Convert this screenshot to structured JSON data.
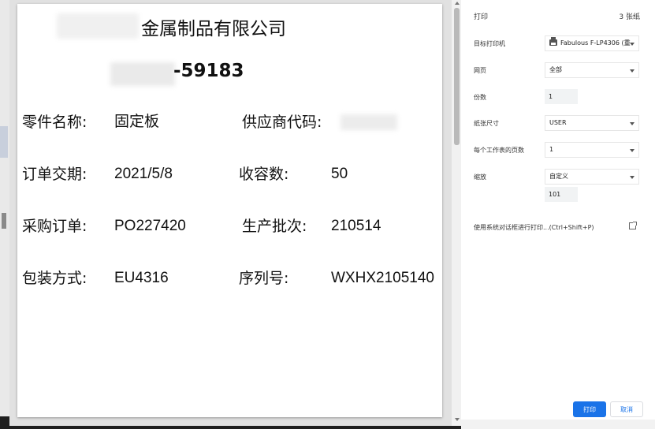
{
  "document": {
    "company_suffix": "金属制品有限公司",
    "code_suffix": "-59183",
    "fields": [
      {
        "label": "零件名称:",
        "value": "固定板"
      },
      {
        "label": "供应商代码:",
        "value": ""
      },
      {
        "label": "订单交期:",
        "value": "2021/5/8"
      },
      {
        "label": "收容数:",
        "value": "50"
      },
      {
        "label": "采购订单:",
        "value": "PO227420"
      },
      {
        "label": "生产批次:",
        "value": "210514"
      },
      {
        "label": "包装方式:",
        "value": "EU4316"
      },
      {
        "label": "序列号:",
        "value": "WXHX2105140"
      }
    ]
  },
  "print_panel": {
    "title": "打印",
    "sheet_count": "3 张纸",
    "destination": {
      "label": "目标打印机",
      "value": "Fabulous F-LP4306 (重",
      "icon": "printer-icon"
    },
    "pages": {
      "label": "网页",
      "value": "全部"
    },
    "copies": {
      "label": "份数",
      "value": "1"
    },
    "paper_size": {
      "label": "纸张尺寸",
      "value": "USER"
    },
    "pages_per_sheet": {
      "label": "每个工作表的页数",
      "value": "1"
    },
    "scale": {
      "label": "缩放",
      "value": "自定义",
      "custom": "101"
    },
    "system_dialog": "使用系统对话框进行打印...(Ctrl+Shift+P)",
    "print_button": "打印",
    "cancel_button": "取消"
  },
  "colors": {
    "accent": "#1a73e8",
    "preview_bg": "#e1e1e1"
  }
}
